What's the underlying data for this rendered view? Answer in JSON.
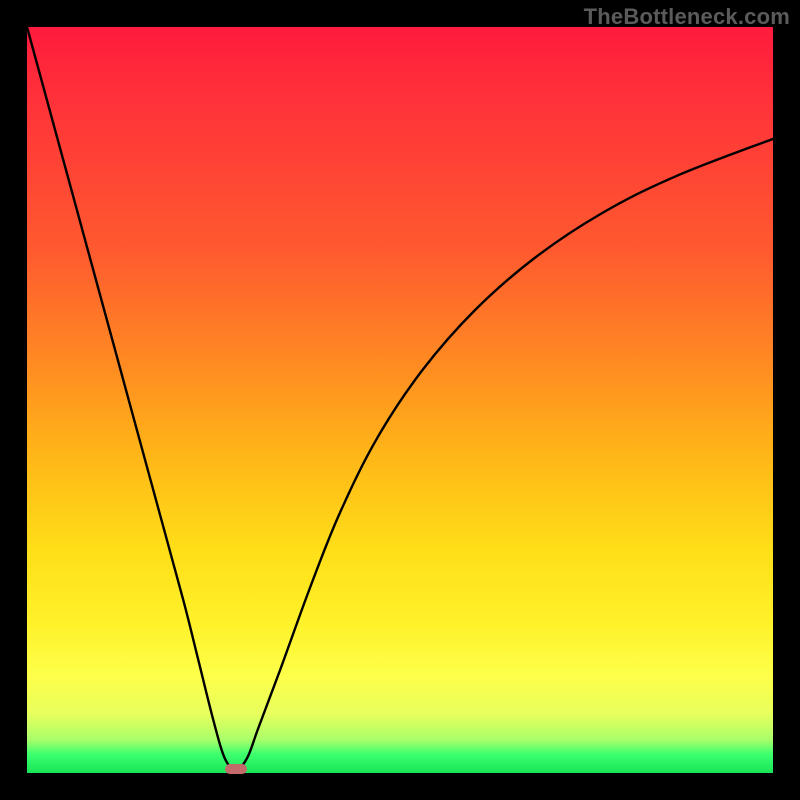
{
  "watermark": "TheBottleneck.com",
  "chart_data": {
    "type": "line",
    "title": "",
    "xlabel": "",
    "ylabel": "",
    "xlim": [
      0,
      100
    ],
    "ylim": [
      0,
      100
    ],
    "grid": false,
    "series": [
      {
        "name": "bottleneck-curve",
        "x": [
          0,
          3,
          6,
          9,
          12,
          15,
          18,
          21,
          23,
          25,
          26.5,
          28,
          29.5,
          31,
          34,
          38,
          42,
          47,
          53,
          60,
          68,
          77,
          87,
          100
        ],
        "y": [
          100,
          89,
          78,
          67,
          56,
          45,
          34,
          23,
          15,
          7,
          2,
          0.5,
          2,
          6,
          14,
          25,
          35,
          45,
          54,
          62,
          69,
          75,
          80,
          85
        ]
      }
    ],
    "marker": {
      "x": 28,
      "y": 0.5,
      "color": "#c36b6b"
    },
    "background_gradient": [
      "#ff1a3d",
      "#ff8a22",
      "#ffde18",
      "#fdff4a",
      "#18e657"
    ]
  }
}
